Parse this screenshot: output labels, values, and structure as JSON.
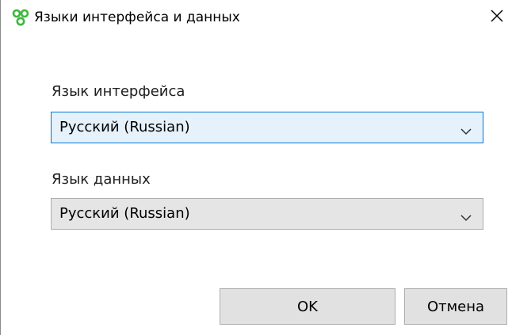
{
  "window": {
    "title": "Языки интерфейса и данных",
    "app_icon": "app-logo-icon",
    "close_icon": "close-icon"
  },
  "interface_language": {
    "label": "Язык интерфейса",
    "selected": "Русский (Russian)"
  },
  "data_language": {
    "label": "Язык данных",
    "selected": "Русский (Russian)"
  },
  "buttons": {
    "ok_label": "OK",
    "cancel_label": "Отмена"
  },
  "colors": {
    "focus_border": "#0078d7",
    "focus_background": "#e5f1fb",
    "icon_green": "#3cb83c"
  }
}
